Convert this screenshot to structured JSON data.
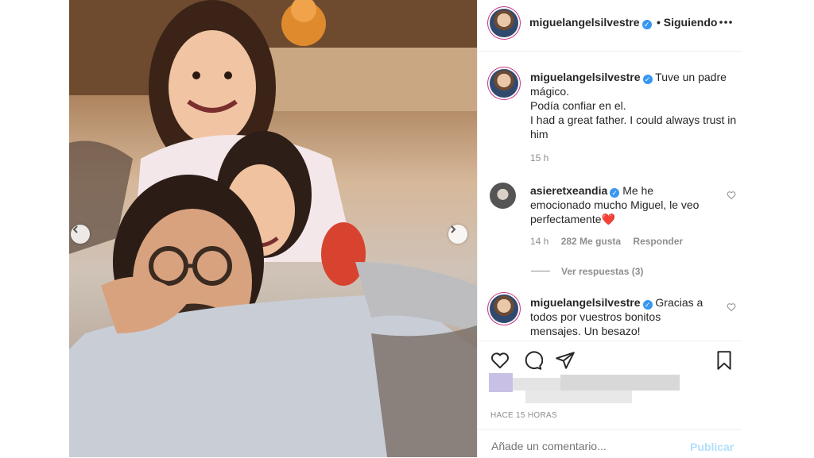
{
  "post": {
    "username": "miguelangelsilvestre",
    "follow_status": "• Siguiendo",
    "more_icon": "more-horizontal-icon"
  },
  "caption": {
    "username": "miguelangelsilvestre",
    "lines": [
      "Tuve un padre",
      "mágico.",
      "Podía confiar en el.",
      "I had a great father. I could always trust in",
      "him"
    ],
    "time": "15 h"
  },
  "comments": [
    {
      "username": "asieretxeandia",
      "lines": [
        "Me he",
        "emocionado mucho Miguel, le veo",
        "perfectamente❤️"
      ],
      "time": "14 h",
      "likes": "282 Me gusta",
      "reply": "Responder",
      "view_replies": "Ver respuestas (3)"
    },
    {
      "username": "miguelangelsilvestre",
      "lines": [
        "Gracias a",
        "todos por vuestros bonitos",
        "mensajes. Un besazo!"
      ]
    }
  ],
  "footer": {
    "timestamp": "HACE 15 HORAS",
    "comment_placeholder": "Añade un comentario...",
    "publish": "Publicar"
  },
  "icons": {
    "like": "heart-icon",
    "comment": "comment-icon",
    "share": "send-icon",
    "save": "bookmark-icon",
    "prev": "chevron-left-icon",
    "next": "chevron-right-icon"
  },
  "colors": {
    "verified": "#3897f0",
    "link": "#b2dffc",
    "heart": "#e0245e"
  }
}
